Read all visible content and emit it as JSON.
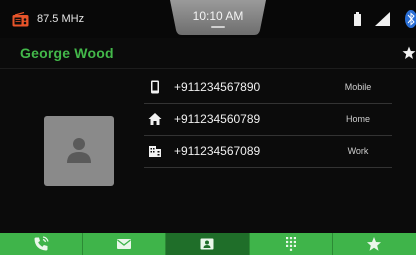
{
  "status_bar": {
    "radio_frequency": "87.5 MHz",
    "time": "10:10 AM",
    "icons": [
      "radio-icon",
      "battery-icon",
      "signal-icon",
      "bluetooth-icon"
    ]
  },
  "contact": {
    "name": "George Wood",
    "favorite_icon": "star-icon",
    "avatar_icon": "person-icon",
    "numbers": [
      {
        "icon": "mobile-phone-icon",
        "number": "+911234567890",
        "type": "Mobile"
      },
      {
        "icon": "home-icon",
        "number": "+911234560789",
        "type": "Home"
      },
      {
        "icon": "work-building-icon",
        "number": "+911234567089",
        "type": "Work"
      }
    ]
  },
  "bottom_nav": {
    "tabs": [
      {
        "icon": "phone-call-icon",
        "active": false
      },
      {
        "icon": "message-icon",
        "active": false
      },
      {
        "icon": "contacts-icon",
        "active": true
      },
      {
        "icon": "dialpad-icon",
        "active": false
      },
      {
        "icon": "favorites-star-icon",
        "active": false
      }
    ]
  },
  "colors": {
    "accent_green": "#43b84a",
    "nav_green": "#3fb44a",
    "nav_active": "#1f6e29",
    "background": "#0b0b0b",
    "radio_orange": "#e8542a"
  }
}
